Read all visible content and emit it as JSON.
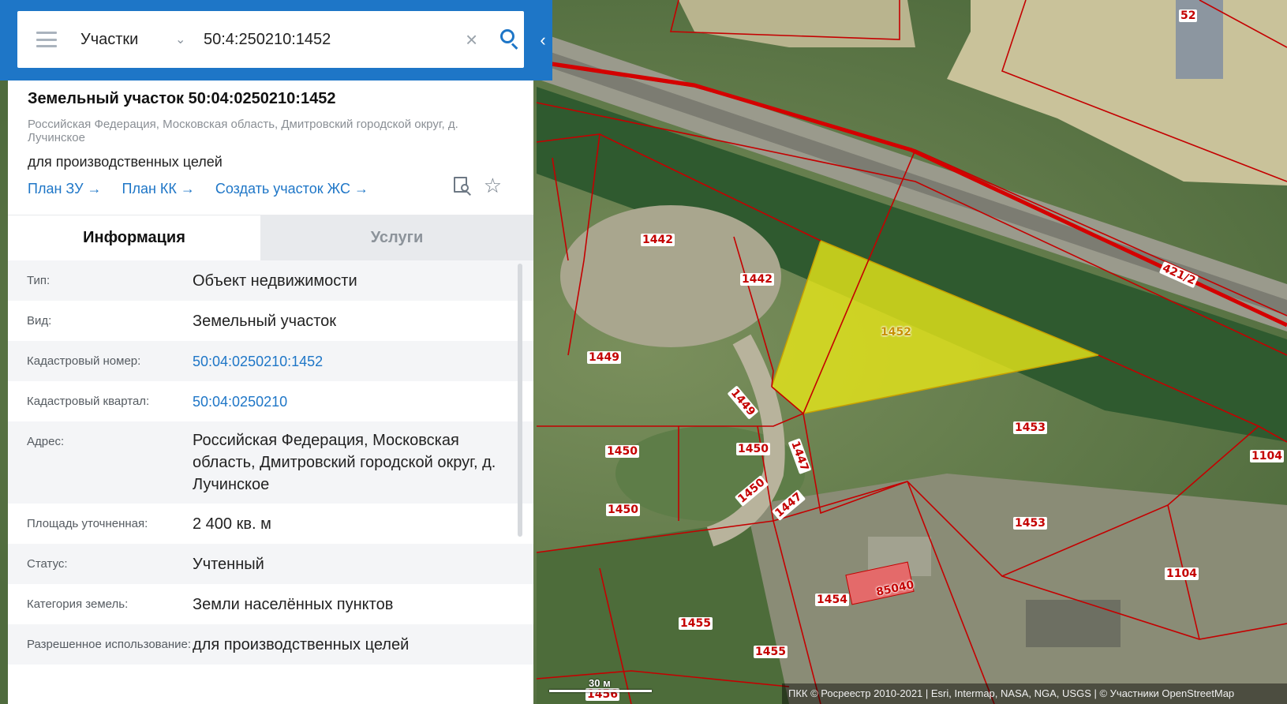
{
  "search": {
    "layer": "Участки",
    "query": "50:4:250210:1452"
  },
  "card": {
    "title": "Земельный участок 50:04:0250210:1452",
    "address": "Российская Федерация, Московская область, Дмитровский городской округ, д. Лучинское",
    "purpose": "для производственных целей",
    "links": {
      "plan_zu": "План ЗУ →",
      "plan_kk": "План КК →",
      "create_zhs": "Создать участок ЖС →"
    }
  },
  "tabs": {
    "info": "Информация",
    "services": "Услуги"
  },
  "info": {
    "type_label": "Тип:",
    "type_value": "Объект недвижимости",
    "kind_label": "Вид:",
    "kind_value": "Земельный участок",
    "cad_num_label": "Кадастровый номер:",
    "cad_num_value": "50:04:0250210:1452",
    "cad_block_label": "Кадастровый квартал:",
    "cad_block_value": "50:04:0250210",
    "address_label": "Адрес:",
    "address_value": "Российская Федерация, Московская область, Дмитровский городской округ, д. Лучинское",
    "area_label": "Площадь уточненная:",
    "area_value": "2 400 кв. м",
    "status_label": "Статус:",
    "status_value": "Учтенный",
    "category_label": "Категория земель:",
    "category_value": "Земли населённых пунктов",
    "usage_label": "Разрешенное использование:",
    "usage_value": "для производственных целей"
  },
  "map": {
    "parcel_labels": {
      "p52": "52",
      "p1442a": "1442",
      "p1442b": "1442",
      "p1452": "1452",
      "p4212": "421/2",
      "p1449a": "1449",
      "p1449b": "1449",
      "p1450a": "1450",
      "p1450b": "1450",
      "p1450c": "1450",
      "p1450d": "1450",
      "p1447a": "1447",
      "p1447b": "1447",
      "p1453a": "1453",
      "p1453b": "1453",
      "p1104a": "1104",
      "p1104b": "1104",
      "p85040": "85040",
      "p1454": "1454",
      "p1455a": "1455",
      "p1455b": "1455",
      "p1456": "1456"
    },
    "scale_label": "30 м",
    "attribution": "ПКК © Росреестр 2010-2021 | Esri, Intermap, NASA, NGA, USGS | © Участники OpenStreetMap",
    "colors": {
      "parcel_border": "#c40000",
      "selected_fill": "#e6e619",
      "accent": "#1e76c7"
    }
  }
}
